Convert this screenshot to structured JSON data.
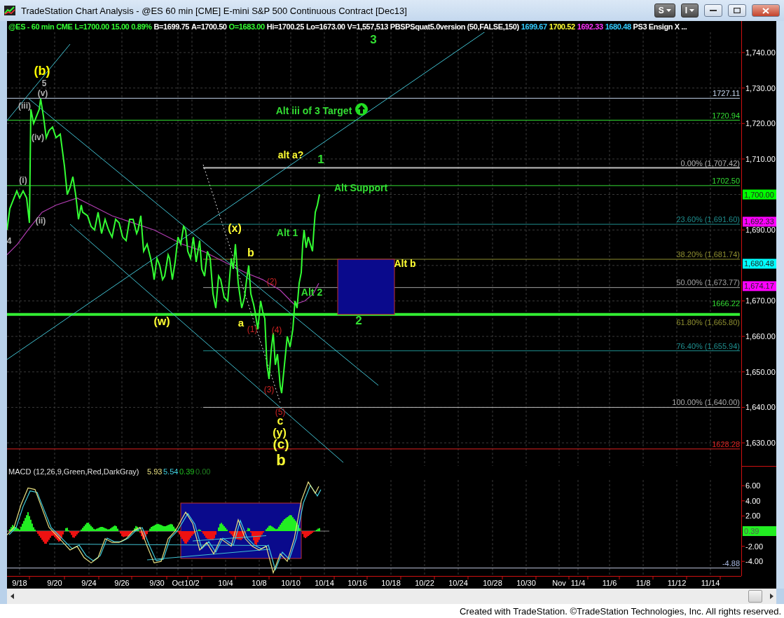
{
  "window": {
    "title": "TradeStation Chart Analysis - @ES 60 min [CME] E-mini S&P 500 Continuous Contract [Dec13]",
    "menu_buttons": [
      {
        "label": "S"
      },
      {
        "label": "I"
      }
    ]
  },
  "status_line": [
    {
      "text": "@ES - 60 min",
      "color": "#33ff33"
    },
    {
      "text": "CME",
      "color": "#33ff33"
    },
    {
      "text": "L=1700.00",
      "color": "#33ff33"
    },
    {
      "text": "15.00",
      "color": "#33ff33"
    },
    {
      "text": "0.89%",
      "color": "#33ff33"
    },
    {
      "text": "B=1699.75",
      "color": "#ffffff"
    },
    {
      "text": "A=1700.50",
      "color": "#ffffff"
    },
    {
      "text": "O=1683.00",
      "color": "#33ff33"
    },
    {
      "text": "Hi=1700.25",
      "color": "#ffffff"
    },
    {
      "text": "Lo=1673.00",
      "color": "#ffffff"
    },
    {
      "text": "V=1,557,513",
      "color": "#ffffff"
    },
    {
      "text": "PBSPSquat5.0version (50,FALSE,150)",
      "color": "#ffffff"
    },
    {
      "text": "1699.67",
      "color": "#33ccff"
    },
    {
      "text": "1700.52",
      "color": "#ffff33"
    },
    {
      "text": "1692.33",
      "color": "#ff33ff"
    },
    {
      "text": "1680.48",
      "color": "#33ccff"
    },
    {
      "text": "PS3 Ensign X ...",
      "color": "#ffffff"
    }
  ],
  "price_axis": [
    "1,740.00",
    "1,730.00",
    "1,720.00",
    "1,710.00",
    "1,690.00",
    "1,670.00",
    "1,660.00",
    "1,650.00",
    "1,640.00",
    "1,630.00"
  ],
  "price_tags": [
    {
      "text": "1,700.00",
      "color": "#00ff00"
    },
    {
      "text": "1,692.33",
      "color": "#ff00ff"
    },
    {
      "text": "1,680.48",
      "color": "#00ffff"
    },
    {
      "text": "1,674.17",
      "color": "#ff00ff"
    }
  ],
  "level_labels": [
    {
      "text": "1727.11",
      "color": "#c8d8f0"
    },
    {
      "text": "1720.94",
      "color": "#33dd33"
    },
    {
      "text": "0.00% (1,707.42)",
      "color": "#b4b4b4"
    },
    {
      "text": "1702.50",
      "color": "#33dd33"
    },
    {
      "text": "23.60% (1,691.60)",
      "color": "#1f8f8f"
    },
    {
      "text": "38.20% (1,681.74)",
      "color": "#8f8f30"
    },
    {
      "text": "50.00% (1,673.77)",
      "color": "#a0a0a0"
    },
    {
      "text": "1666.22",
      "color": "#33dd33"
    },
    {
      "text": "61.80% (1,665.80)",
      "color": "#8f8f30"
    },
    {
      "text": "76.40% (1,655.94)",
      "color": "#1f8f8f"
    },
    {
      "text": "100.00% (1,640.00)",
      "color": "#a8a8a8"
    },
    {
      "text": "1628.28",
      "color": "#dd2020"
    }
  ],
  "wave_labels": [
    {
      "text": "(b)",
      "color": "#ffff00"
    },
    {
      "text": "5",
      "color": "#b0b0b0"
    },
    {
      "text": "(v)",
      "color": "#b0b0b0"
    },
    {
      "text": "(iii)",
      "color": "#b0b0b0"
    },
    {
      "text": "(iv)",
      "color": "#b0b0b0"
    },
    {
      "text": "(i)",
      "color": "#b0b0b0"
    },
    {
      "text": "(ii)",
      "color": "#b0b0b0"
    },
    {
      "text": "4",
      "color": "#b0b0b0"
    },
    {
      "text": "3",
      "color": "#33dd33"
    },
    {
      "text": "Alt iii of 3 Target",
      "color": "#33dd33"
    },
    {
      "text": "alt a?",
      "color": "#ffff33"
    },
    {
      "text": "1",
      "color": "#33dd33"
    },
    {
      "text": "Alt Support",
      "color": "#33dd33"
    },
    {
      "text": "(x)",
      "color": "#ffff33"
    },
    {
      "text": "Alt 1",
      "color": "#33dd33"
    },
    {
      "text": "b",
      "color": "#ffff33"
    },
    {
      "text": "Alt b",
      "color": "#ffff33"
    },
    {
      "text": "(2)",
      "color": "#cc2222"
    },
    {
      "text": "Alt 2",
      "color": "#33dd33"
    },
    {
      "text": "(w)",
      "color": "#ffff33"
    },
    {
      "text": "a",
      "color": "#ffff33"
    },
    {
      "text": "(1)",
      "color": "#cc2222"
    },
    {
      "text": "(4)",
      "color": "#cc2222"
    },
    {
      "text": "2",
      "color": "#33dd33"
    },
    {
      "text": "(3)",
      "color": "#cc2222"
    },
    {
      "text": "(5)",
      "color": "#cc2222"
    },
    {
      "text": "c",
      "color": "#ffff33"
    },
    {
      "text": "(y)",
      "color": "#ffff33"
    },
    {
      "text": "(c)",
      "color": "#ffff33"
    },
    {
      "text": "b",
      "color": "#ffff33"
    }
  ],
  "macd": {
    "title": "MACD (12,26,9,Green,Red,DarkGray)",
    "values": [
      {
        "text": "5.93",
        "color": "#e8e080"
      },
      {
        "text": "5.54",
        "color": "#40d0e0"
      },
      {
        "text": "0.39",
        "color": "#20c020"
      },
      {
        "text": "0.00",
        "color": "#208020"
      }
    ],
    "axis": [
      "6.00",
      "4.00",
      "2.00",
      "-2.00",
      "-4.00"
    ],
    "tag": "0.39",
    "line_label": "-4.88"
  },
  "date_axis": [
    "9/18",
    "9/20",
    "9/24",
    "9/26",
    "9/30",
    "Oct",
    "10/2",
    "10/4",
    "10/8",
    "10/10",
    "10/14",
    "10/16",
    "10/18",
    "10/22",
    "10/24",
    "10/28",
    "10/30",
    "Nov",
    "11/4",
    "11/6",
    "11/8",
    "11/12",
    "11/14"
  ],
  "footer": "Created with TradeStation. ©TradeStation Technologies, Inc. All rights reserved."
}
